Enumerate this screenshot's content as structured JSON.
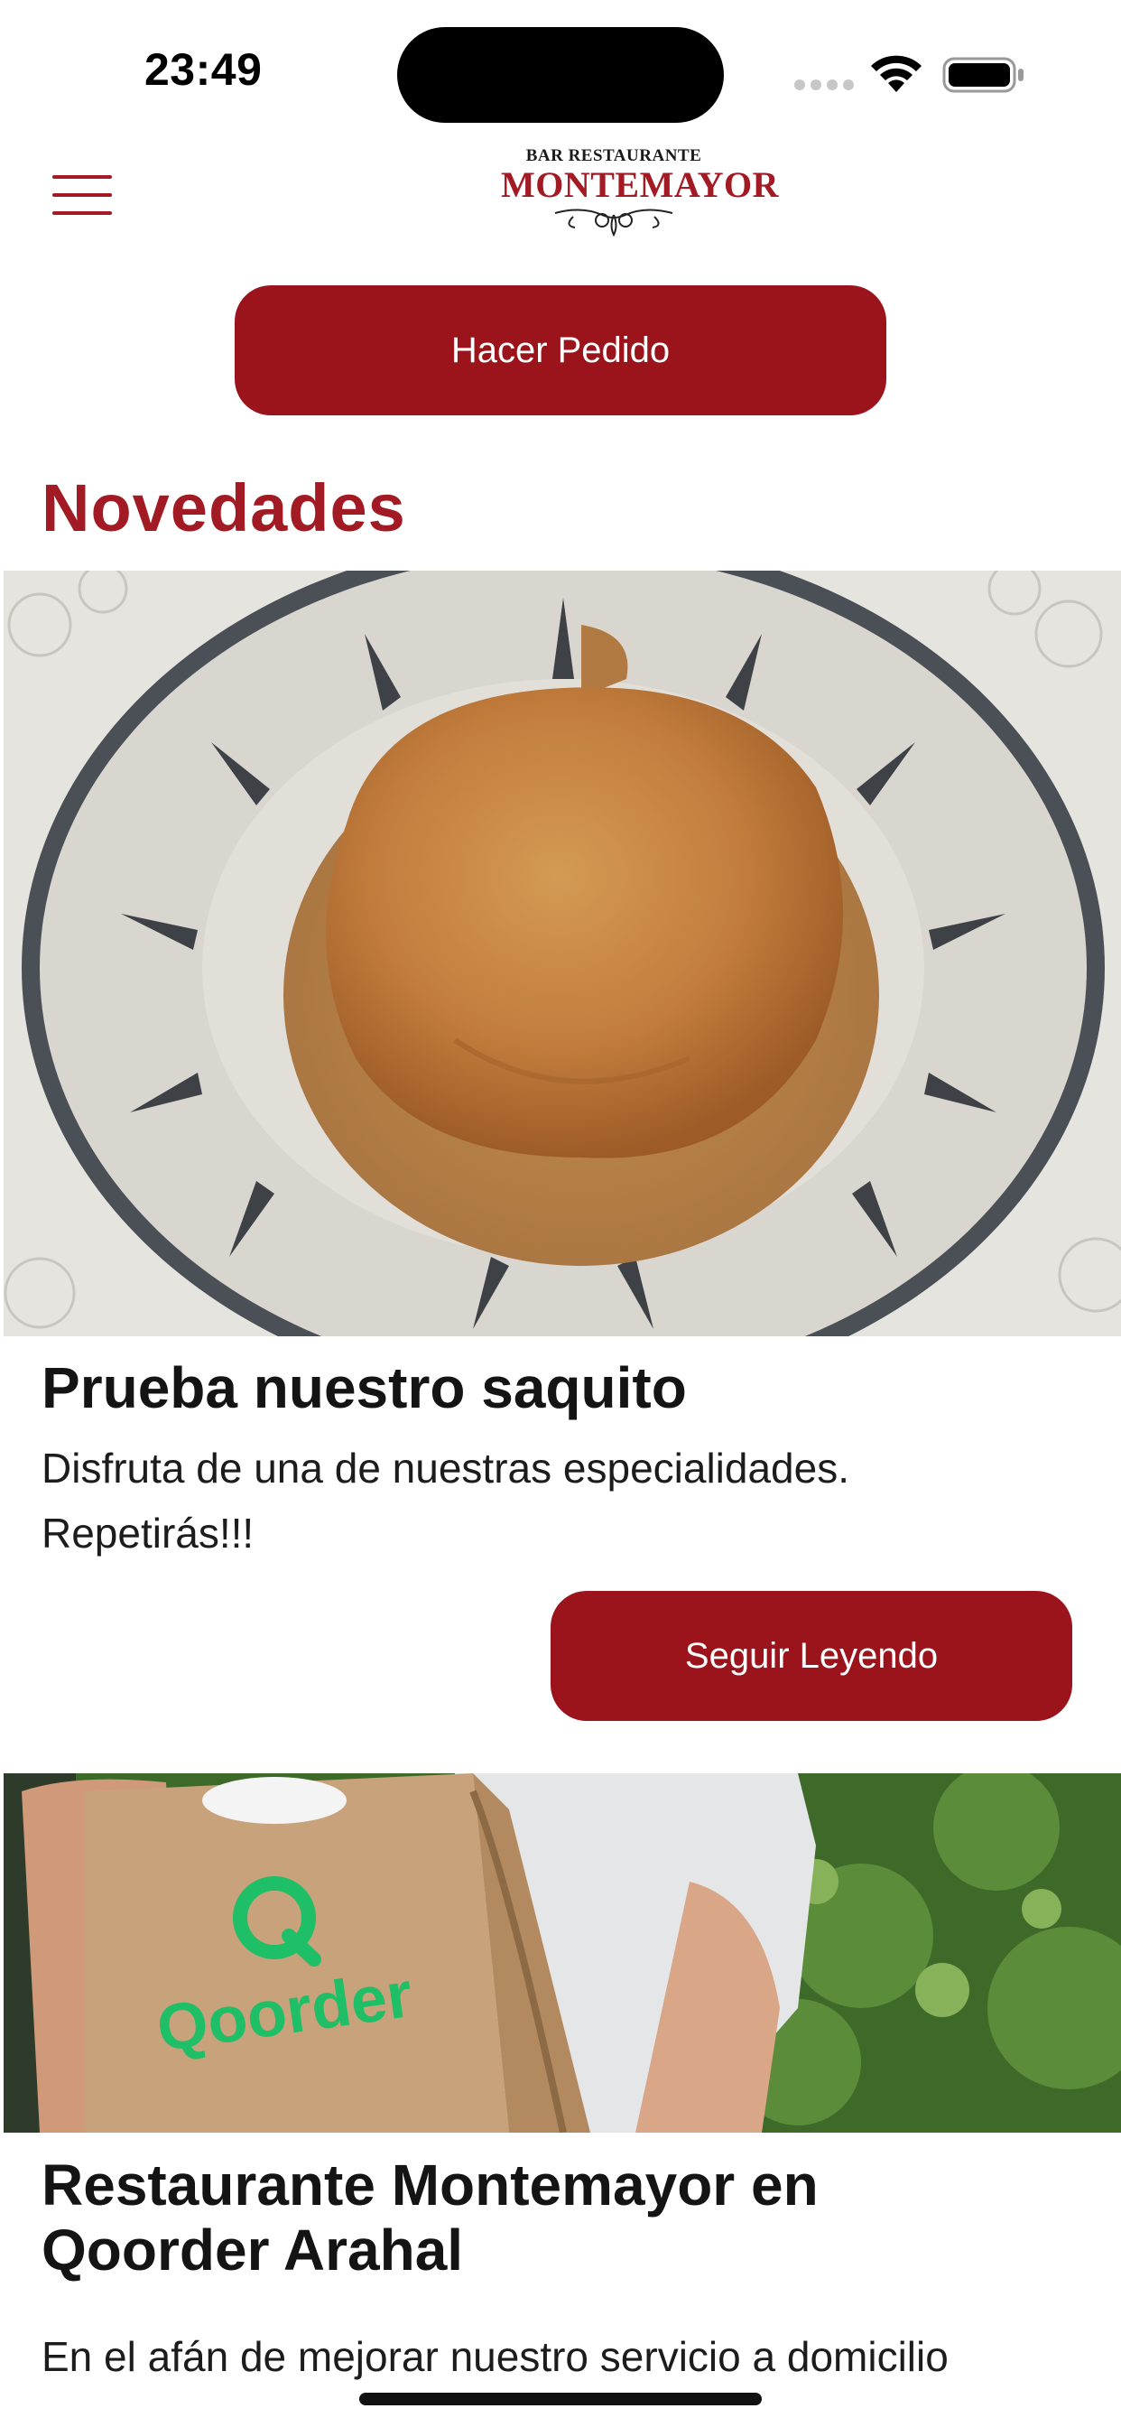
{
  "status_bar": {
    "time": "23:49"
  },
  "header": {
    "logo_top": "BAR RESTAURANTE",
    "logo_main": "MONTEMAYOR",
    "menu_icon": "hamburger-menu-icon"
  },
  "actions": {
    "order_label": "Hacer Pedido"
  },
  "section": {
    "title": "Novedades"
  },
  "news": [
    {
      "title": "Prueba nuestro saquito",
      "description": "Disfruta de una de nuestras especialidades. Repetirás!!!",
      "button_label": "Seguir Leyendo"
    },
    {
      "title": "Restaurante Montemayor en Qoorder Arahal",
      "description": "En el afán de mejorar nuestro servicio a domicilio",
      "image_text": "Qoorder"
    }
  ],
  "colors": {
    "accent": "#9c141b",
    "title": "#a11a24"
  }
}
